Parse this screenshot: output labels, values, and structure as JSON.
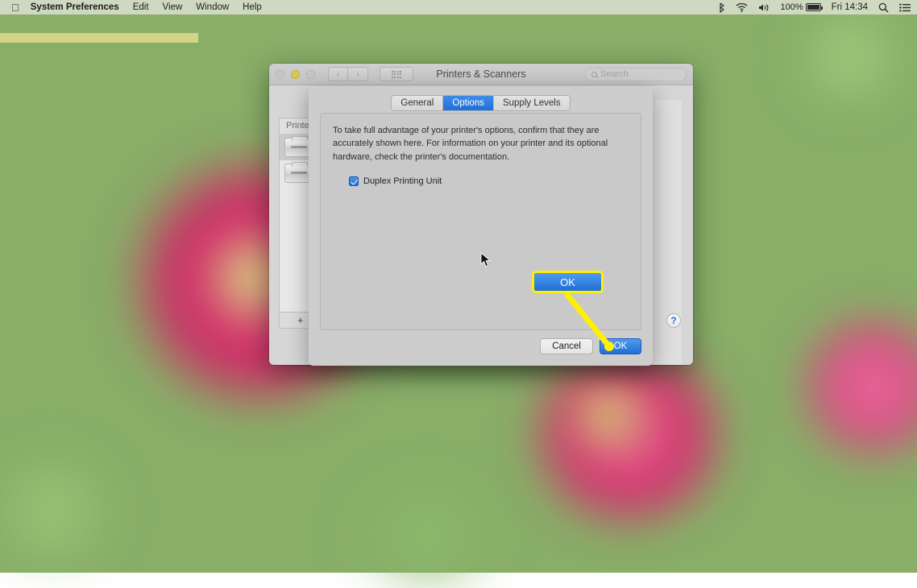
{
  "menubar": {
    "apple_glyph": "",
    "items": [
      {
        "label": "System Preferences",
        "bold": true
      },
      {
        "label": "Edit",
        "bold": false
      },
      {
        "label": "View",
        "bold": false
      },
      {
        "label": "Window",
        "bold": false
      },
      {
        "label": "Help",
        "bold": false
      }
    ],
    "status": {
      "bluetooth_icon": "bluetooth-icon",
      "wifi_icon": "wifi-icon",
      "volume_icon": "volume-icon",
      "battery_percent": "100%",
      "battery_icon": "battery-icon",
      "clock": "Fri 14:34",
      "search_icon": "spotlight-search-icon",
      "notification_icon": "notification-center-icon"
    }
  },
  "window": {
    "title": "Printers & Scanners",
    "traffic_lights": {
      "close": "close-button",
      "minimize": "minimize-button",
      "zoom": "zoom-button"
    },
    "nav": {
      "back": "‹",
      "forward": "›",
      "show_all": "show-all-grid-button"
    },
    "search": {
      "placeholder": "Search",
      "value": ""
    },
    "sidebar": {
      "header": "Printers",
      "items": [
        {
          "name": "printer-item-1",
          "selected": true
        },
        {
          "name": "printer-item-2",
          "selected": false
        }
      ],
      "tools": {
        "add": "+",
        "remove": "−"
      }
    },
    "options_button_label": "…",
    "help_button_label": "?"
  },
  "sheet": {
    "tabs": [
      {
        "label": "General",
        "active": false
      },
      {
        "label": "Options",
        "active": true
      },
      {
        "label": "Supply Levels",
        "active": false
      }
    ],
    "description": "To take full advantage of your printer's options, confirm that they are accurately shown here. For information on your printer and its optional hardware, check the printer's documentation.",
    "checkbox": {
      "label": "Duplex Printing Unit",
      "checked": true
    },
    "buttons": {
      "cancel": "Cancel",
      "ok": "OK"
    }
  },
  "annotation": {
    "callout_label": "OK",
    "highlight_color": "#fff000",
    "accent_color": "#1f6ed6"
  }
}
